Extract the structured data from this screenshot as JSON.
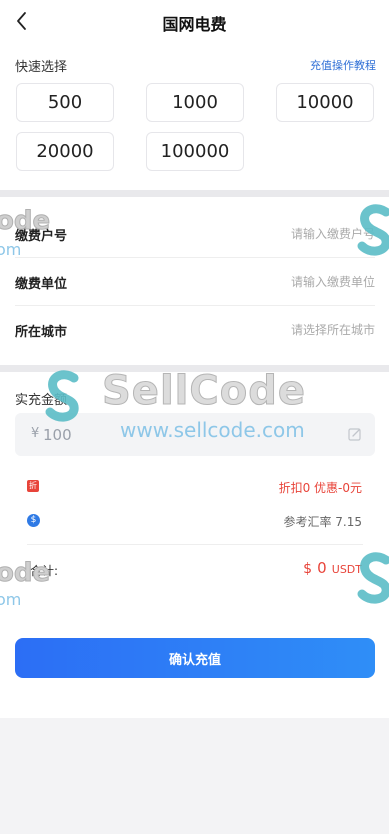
{
  "header": {
    "title": "国网电费",
    "back_icon": "chevron-left-icon"
  },
  "quick_select": {
    "label": "快速选择",
    "help_link": "充值操作教程",
    "amounts": [
      "500",
      "1000",
      "10000",
      "20000",
      "100000"
    ]
  },
  "form": {
    "account": {
      "label": "缴费户号",
      "placeholder": "请输入缴费户号"
    },
    "unit": {
      "label": "缴费单位",
      "placeholder": "请输入缴费单位"
    },
    "city": {
      "label": "所在城市",
      "placeholder": "请选择所在城市"
    }
  },
  "payment": {
    "label": "实充金额",
    "currency_symbol": "¥",
    "amount_placeholder": "100",
    "discount_icon_text": "折",
    "discount_text": "折扣0 优惠-0元",
    "rate_icon_text": "$",
    "rate_text": "参考汇率 7.15",
    "total_label": "合计:",
    "total_symbol": "$",
    "total_value": "0",
    "total_unit": "USDT"
  },
  "confirm_button": "确认充值",
  "watermark": {
    "brand": "SellCode",
    "url": "www.sellcode.com",
    "left_brand": "ode",
    "left_url": "om"
  },
  "colors": {
    "accent": "#2c6ef5",
    "price": "#e8443a",
    "link": "#2f6fd6",
    "watermark_s": "#5bbcc7"
  }
}
